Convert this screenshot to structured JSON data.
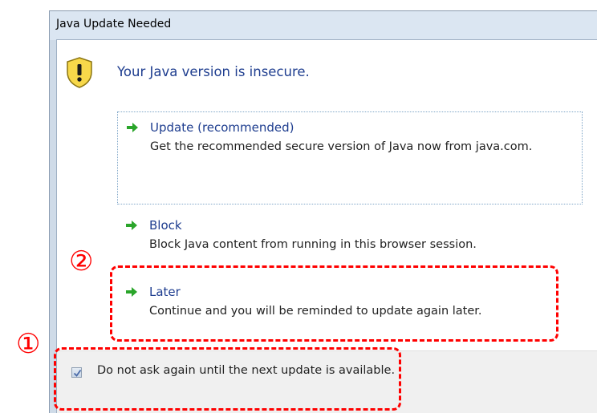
{
  "window": {
    "title": "Java Update Needed"
  },
  "header": {
    "message": "Your Java version is insecure."
  },
  "options": [
    {
      "title": "Update (recommended)",
      "description": "Get the recommended secure version of Java now from java.com."
    },
    {
      "title": "Block",
      "description": "Block Java content from running in this browser session."
    },
    {
      "title": "Later",
      "description": "Continue and you will be reminded to update again later."
    }
  ],
  "footer": {
    "checkbox_label": "Do not ask again until the next update is available.",
    "checkbox_checked": true
  },
  "annotations": {
    "callout_1": "①",
    "callout_2": "②",
    "highlight_color": "#ff0000"
  },
  "icons": {
    "warning": "warning-shield-icon",
    "option_arrow": "green-arrow-icon"
  },
  "colors": {
    "heading_text": "#1e3d8f",
    "arrow": "#2aa52a"
  }
}
